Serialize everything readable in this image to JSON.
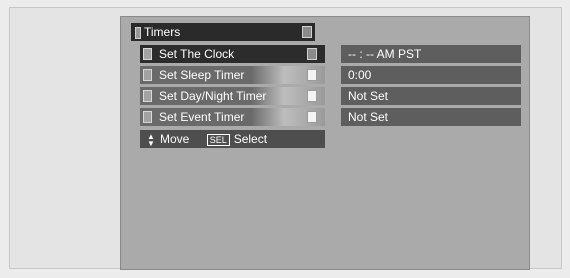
{
  "menu": {
    "title": "Timers",
    "items": [
      {
        "label": "Set The Clock",
        "value": "-- : --  AM PST",
        "selected": true
      },
      {
        "label": "Set Sleep Timer",
        "value": "0:00",
        "selected": false
      },
      {
        "label": "Set Day/Night Timer",
        "value": "Not Set",
        "selected": false
      },
      {
        "label": "Set Event Timer",
        "value": "Not Set",
        "selected": false
      }
    ]
  },
  "hints": {
    "arrows_icon": "up-down-arrows-icon",
    "move_label": "Move",
    "sel_key_label": "SEL",
    "select_label": "Select"
  },
  "colors": {
    "background": "#aaaaaa",
    "selected_item": "#2c2c2c",
    "item": "#6a6a6a",
    "value_bg": "#5e5e5e",
    "text": "#ffffff"
  }
}
